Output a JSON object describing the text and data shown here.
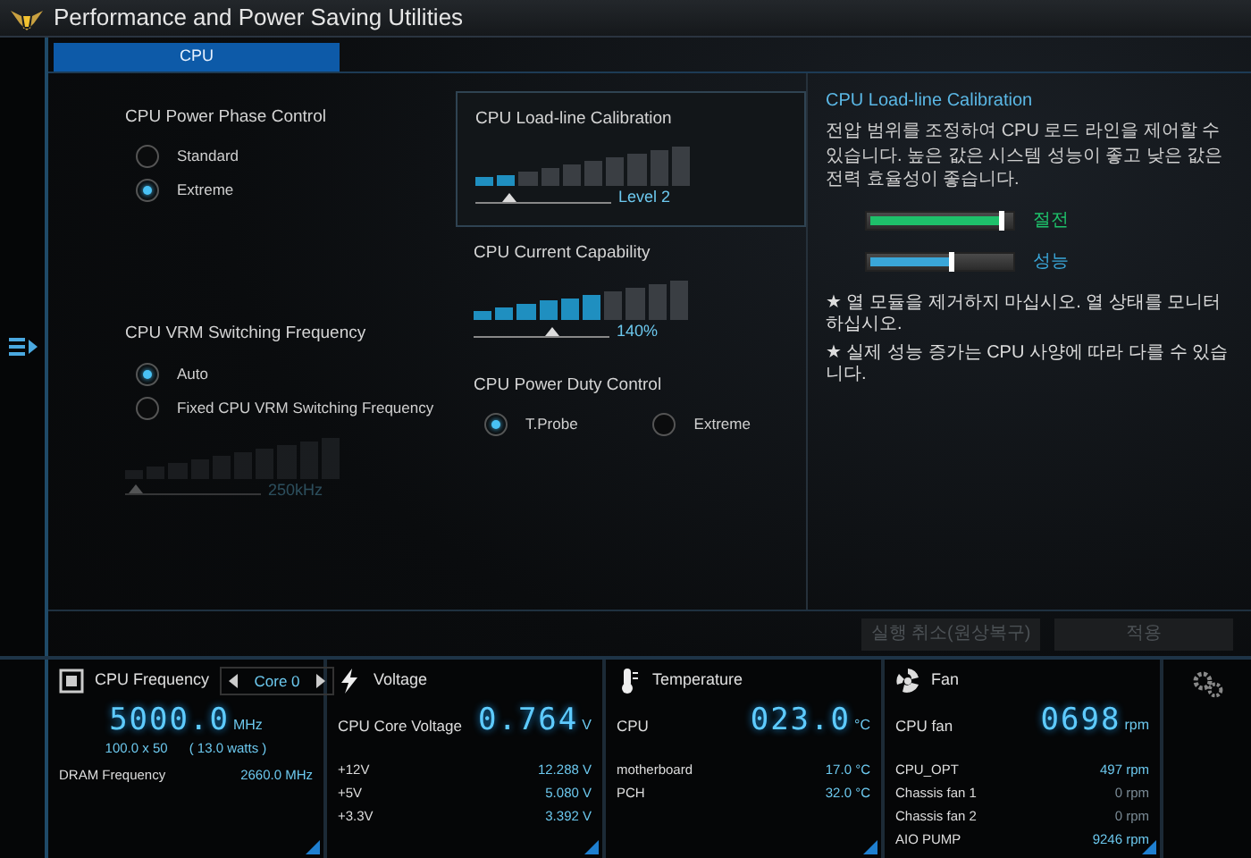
{
  "window": {
    "title": "Performance and Power Saving Utilities"
  },
  "tabs": [
    {
      "label": "CPU",
      "selected": true
    }
  ],
  "left_column": [
    {
      "title": "CPU Power Phase Control",
      "options": [
        {
          "label": "Standard",
          "selected": false
        },
        {
          "label": "Extreme",
          "selected": true
        }
      ]
    },
    {
      "title": "CPU VRM Switching Frequency",
      "options": [
        {
          "label": "Auto",
          "selected": true
        },
        {
          "label": "Fixed CPU VRM Switching Frequency",
          "selected": false
        }
      ],
      "slider": {
        "level": 0,
        "reading": "250kHz",
        "disabled": true
      }
    }
  ],
  "right_column": [
    {
      "title": "CPU Load-line Calibration",
      "highlighted": true,
      "slider": {
        "level": 0.2,
        "reading": "Level 2"
      }
    },
    {
      "title": "CPU Current Capability",
      "slider": {
        "level": 0.6,
        "reading": "140%"
      }
    },
    {
      "title": "CPU Power Duty Control",
      "inline": true,
      "options": [
        {
          "label": "T.Probe",
          "selected": true
        },
        {
          "label": "Extreme",
          "selected": false
        }
      ]
    }
  ],
  "description": {
    "title": "CPU Load-line Calibration",
    "text": "전압 범위를 조정하여 CPU 로드 라인을 제어할 수 있습니다. 높은 값은 시스템 성능이 좋고 낮은 값은 전력 효율성이 좋습니다.",
    "meters": [
      {
        "label": "절전",
        "level": 0.9,
        "color": "#1ec06a"
      },
      {
        "label": "성능",
        "level": 0.55,
        "color": "#3aa6d8"
      }
    ],
    "notes": [
      "★ 열 모듈을 제거하지 마십시오. 열 상태를 모니터하십시오.",
      "★ 실제 성능 증가는 CPU 사양에 따라 다를 수 있습니다."
    ]
  },
  "buttons": [
    {
      "label": "실행 취소(원상복구)",
      "disabled": true
    },
    {
      "label": "적용",
      "disabled": true
    }
  ],
  "monitor": [
    {
      "kind": "frequency",
      "title": "CPU Frequency",
      "selector": "Core 0",
      "primary": {
        "value": "5000.0",
        "unit": "MHz"
      },
      "sub": [
        "100.0  x  50",
        "( 13.0 watts )"
      ],
      "rows": [
        {
          "label": "DRAM Frequency",
          "value": "2660.0  MHz"
        }
      ]
    },
    {
      "kind": "voltage",
      "title": "Voltage",
      "primary": {
        "label": "CPU Core Voltage",
        "value": "0.764",
        "unit": "V"
      },
      "rows": [
        {
          "label": "+12V",
          "value": "12.288  V"
        },
        {
          "label": "+5V",
          "value": "5.080  V"
        },
        {
          "label": "+3.3V",
          "value": "3.392  V"
        }
      ]
    },
    {
      "kind": "temperature",
      "title": "Temperature",
      "primary": {
        "label": "CPU",
        "value": "023.0",
        "unit": "°C"
      },
      "rows": [
        {
          "label": "motherboard",
          "value": "17.0 °C"
        },
        {
          "label": "PCH",
          "value": "32.0 °C"
        }
      ]
    },
    {
      "kind": "fan",
      "title": "Fan",
      "primary": {
        "label": "CPU fan",
        "value": "0698",
        "unit": "rpm"
      },
      "rows": [
        {
          "label": "CPU_OPT",
          "value": "497  rpm",
          "active": true
        },
        {
          "label": "Chassis fan 1",
          "value": "0  rpm",
          "active": false
        },
        {
          "label": "Chassis fan 2",
          "value": "0  rpm",
          "active": false
        },
        {
          "label": "AIO PUMP",
          "value": "9246  rpm",
          "active": true
        }
      ]
    }
  ]
}
